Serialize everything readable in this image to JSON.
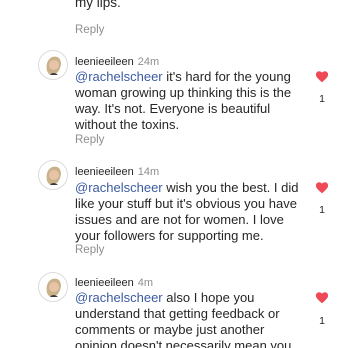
{
  "top_fragment": "my lips.",
  "reply_label": "Reply",
  "accent_like_color": "#ed4956",
  "mention_color": "#3b5ba0",
  "comments": [
    {
      "username": "leenieeileen",
      "time": "24m",
      "mention": "@rachelscheer",
      "text": " it's hard for the young woman growing up thinking this is the way. It's not. Everyone is beautiful without the toxins.",
      "likes": "1"
    },
    {
      "username": "leenieeileen",
      "time": "14m",
      "mention": "@rachelscheer",
      "text": " wish you the best. I did like your stuff but it's obvious you have issues and are not for women. I love your followers for supporting me.",
      "likes": "1"
    },
    {
      "username": "leenieeileen",
      "time": "4m",
      "mention": "@rachelscheer",
      "text": " also I hope you understand that getting feedback or comments or maybe just another opinion doesn't necessarily mean you",
      "likes": "1"
    }
  ]
}
